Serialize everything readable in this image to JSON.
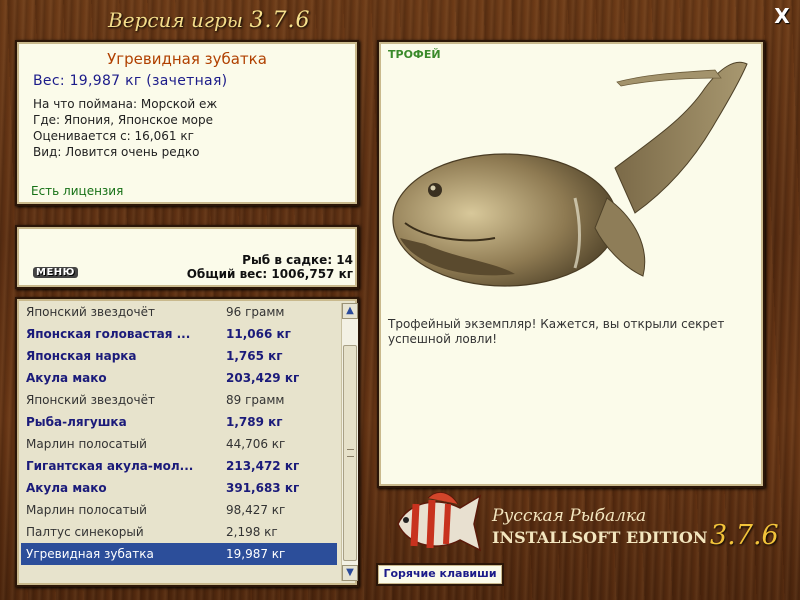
{
  "window": {
    "title_prefix": "Версия игры",
    "version": "3.7.6",
    "close_label": "X"
  },
  "catch": {
    "name": "Угревидная зубатка",
    "weight": "Вес: 19,987 кг (зачетная)",
    "bait": "На что поймана: Морской еж",
    "location": "Где: Япония, Японское море",
    "estimated": "Оценивается с: 16,061 кг",
    "rarity": "Вид: Ловится очень редко",
    "license": "Есть лицензия"
  },
  "cage": {
    "menu_label": "МЕНЮ",
    "count": "Рыб в садке: 14",
    "total": "Общий вес: 1006,757 кг"
  },
  "fish_list": [
    {
      "name": "Японский звездочёт",
      "weight": "96 грамм",
      "style": "normal"
    },
    {
      "name": "Японская головастая ...",
      "weight": "11,066 кг",
      "style": "bold"
    },
    {
      "name": "Японская нарка",
      "weight": "1,765 кг",
      "style": "bold"
    },
    {
      "name": "Акула мако",
      "weight": "203,429 кг",
      "style": "bold"
    },
    {
      "name": "Японский звездочёт",
      "weight": "89 грамм",
      "style": "normal"
    },
    {
      "name": "Рыба-лягушка",
      "weight": "1,789 кг",
      "style": "bold"
    },
    {
      "name": "Марлин полосатый",
      "weight": "44,706 кг",
      "style": "normal"
    },
    {
      "name": "Гигантская акула-мол...",
      "weight": "213,472 кг",
      "style": "bold"
    },
    {
      "name": "Акула мако",
      "weight": "391,683 кг",
      "style": "bold"
    },
    {
      "name": "Марлин полосатый",
      "weight": "98,427 кг",
      "style": "normal"
    },
    {
      "name": "Палтус синекорый",
      "weight": "2,198 кг",
      "style": "normal"
    },
    {
      "name": "Угревидная зубатка",
      "weight": "19,987 кг",
      "style": "selected"
    }
  ],
  "trophy": {
    "label": "ТРОФЕЙ",
    "description": "Трофейный экземпляр! Кажется, вы открыли секрет успешной ловли!"
  },
  "brand": {
    "line1": "Русская Рыбалка",
    "line2": "INSTALLSOFT EDITION",
    "version": "3.7.6"
  },
  "hotkeys_label": "Горячие клавиши",
  "colors": {
    "wood": "#5a2e12",
    "panel": "#fbfbea",
    "accent_title": "#f3dc8a",
    "selection": "#2c4e9a",
    "bold_text": "#1b1b7a"
  }
}
